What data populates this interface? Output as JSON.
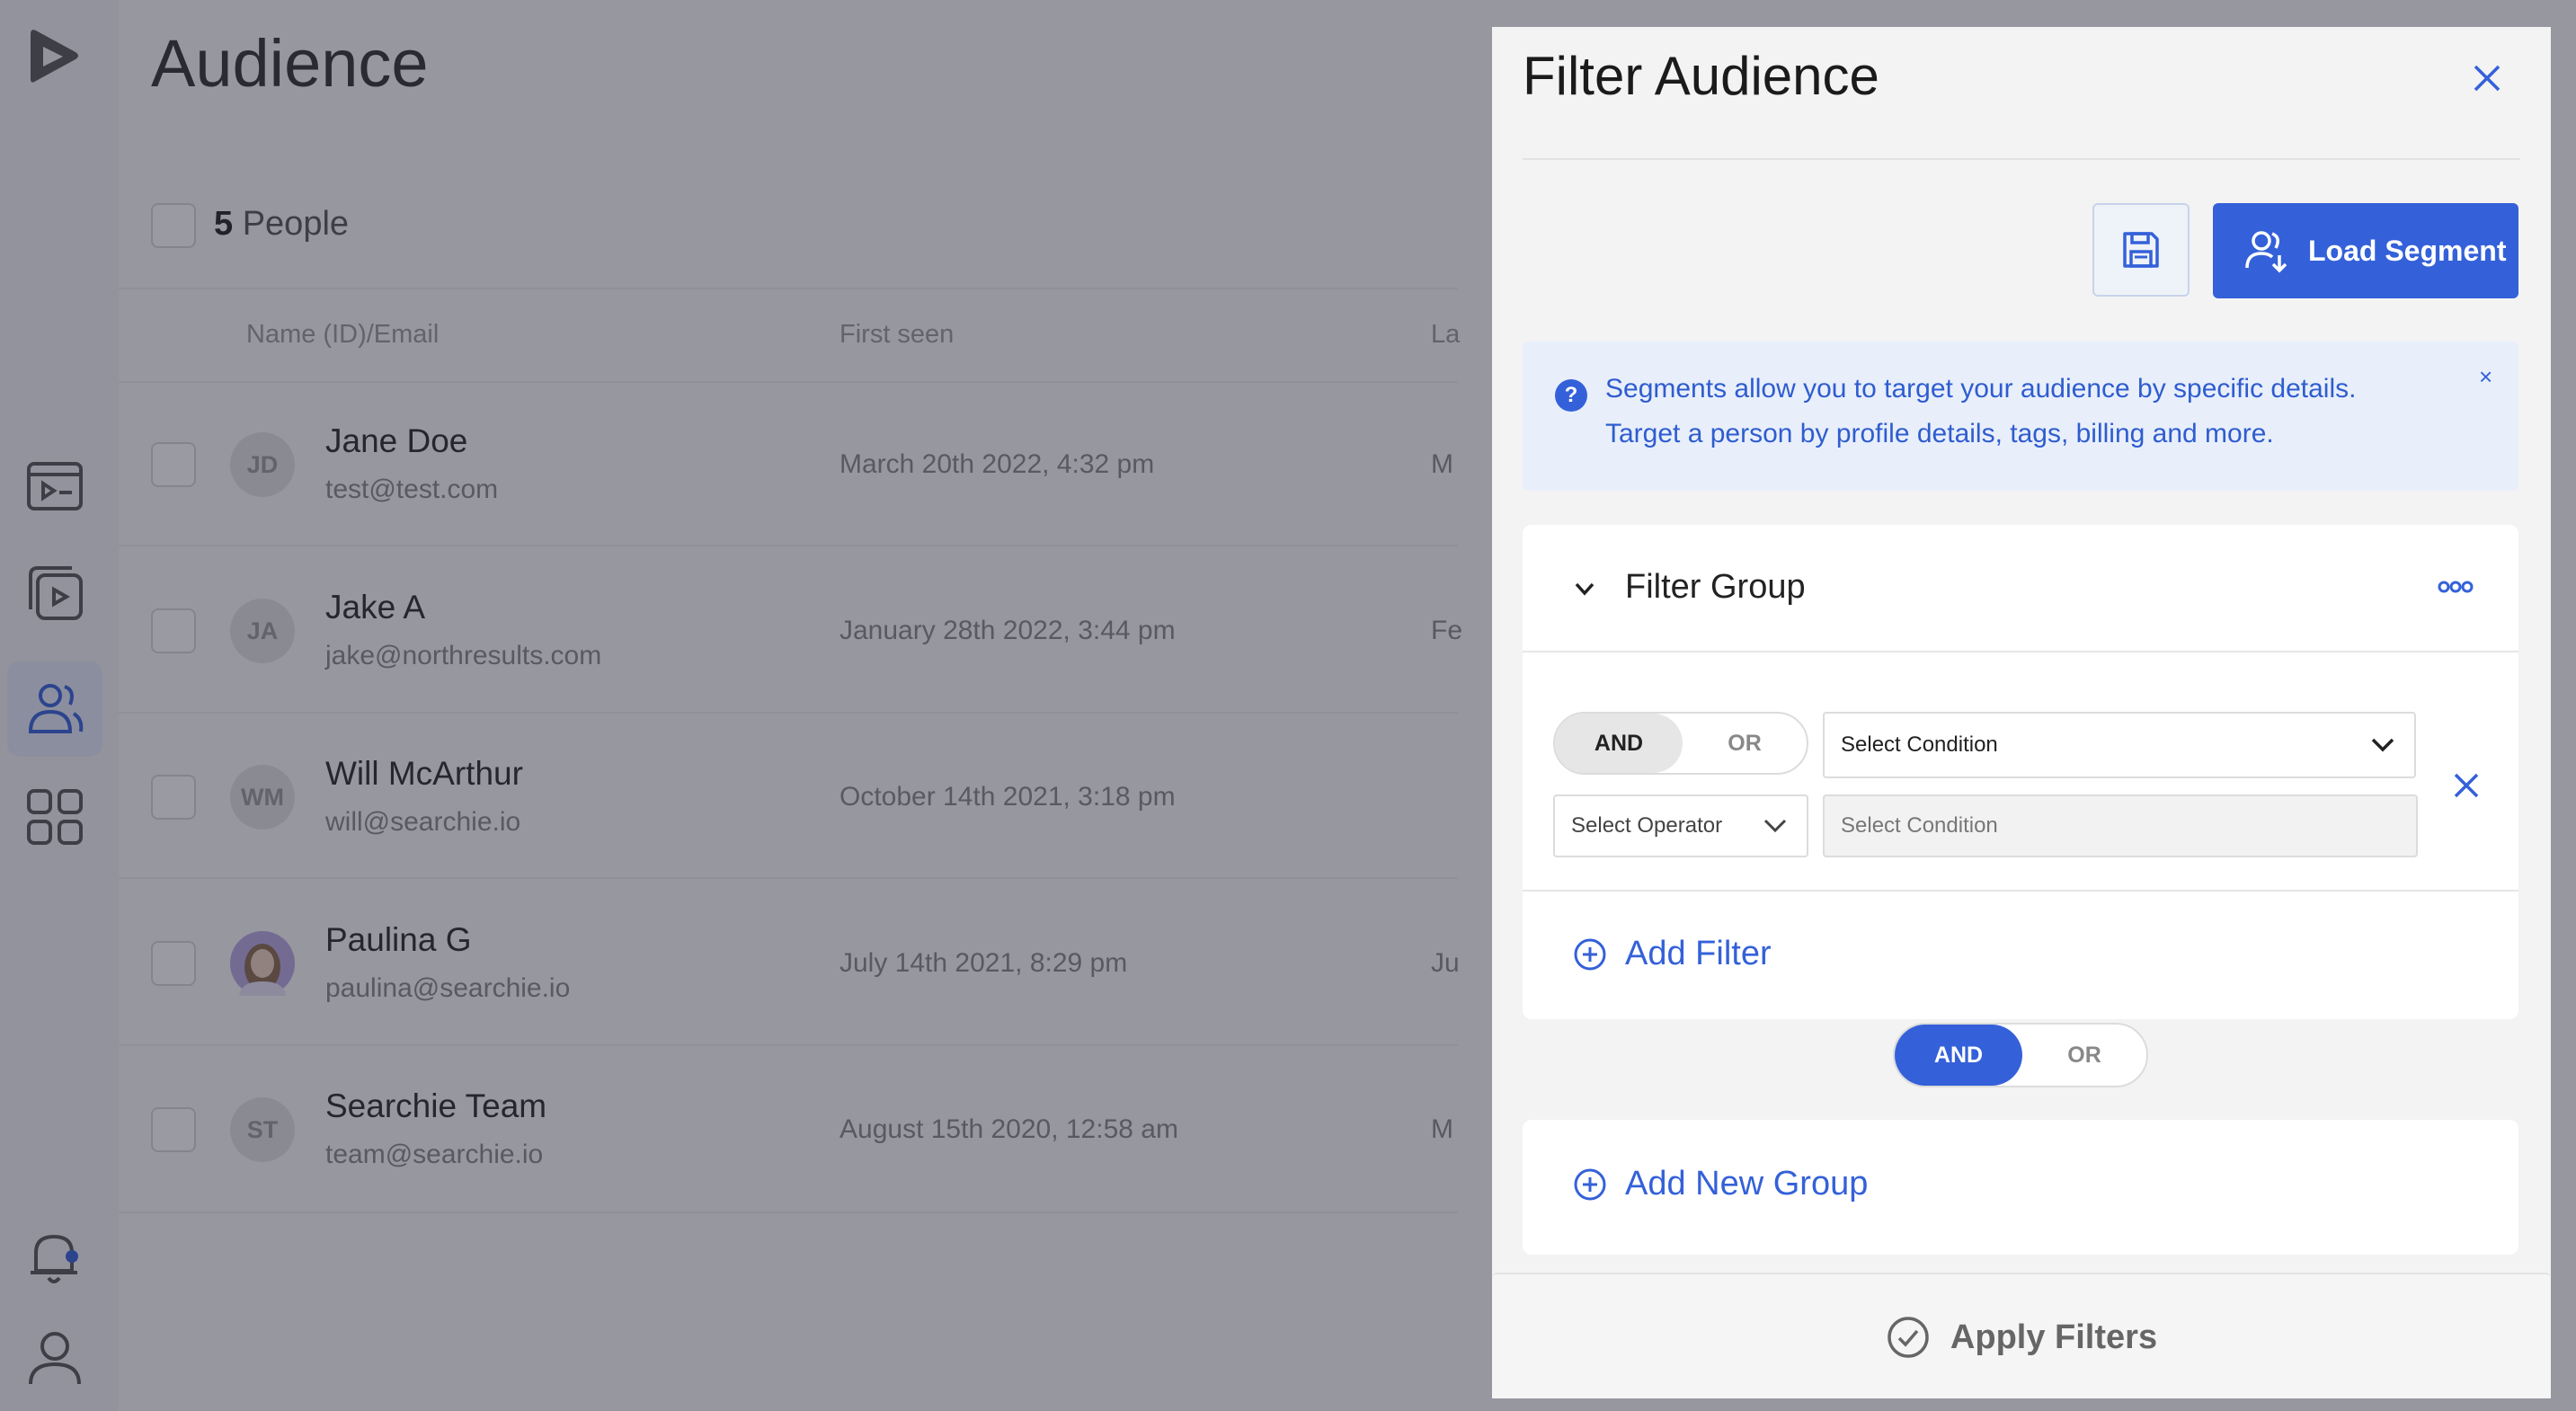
{
  "page": {
    "title": "Audience",
    "count_number": "5",
    "count_label": "People"
  },
  "table": {
    "columns": [
      "Name (ID)/Email",
      "First seen",
      "La"
    ],
    "rows": [
      {
        "initials": "JD",
        "name": "Jane Doe",
        "email": "test@test.com",
        "first_seen": "March 20th 2022, 4:32 pm",
        "last": "M"
      },
      {
        "initials": "JA",
        "name": "Jake A",
        "email": "jake@northresults.com",
        "first_seen": "January 28th 2022, 3:44 pm",
        "last": "Fe"
      },
      {
        "initials": "WM",
        "name": "Will McArthur",
        "email": "will@searchie.io",
        "first_seen": "October 14th 2021, 3:18 pm",
        "last": ""
      },
      {
        "initials": "",
        "name": "Paulina G",
        "email": "paulina@searchie.io",
        "first_seen": "July 14th 2021, 8:29 pm",
        "last": "Ju"
      },
      {
        "initials": "ST",
        "name": "Searchie Team",
        "email": "team@searchie.io",
        "first_seen": "August 15th 2020, 12:58 am",
        "last": "M"
      }
    ]
  },
  "sidebar": {
    "icons": [
      "logo-icon",
      "playlist-icon",
      "video-library-icon",
      "audience-icon",
      "apps-grid-icon",
      "notification-bell-icon",
      "user-profile-icon"
    ]
  },
  "filter_panel": {
    "title": "Filter Audience",
    "load_segment_label": "Load Segment",
    "info_line1": "Segments allow you to target your audience by specific details.",
    "info_line2": "Target a person by profile details, tags, billing and more.",
    "info_close": "×",
    "group": {
      "title": "Filter Group",
      "and_label": "AND",
      "or_label": "OR",
      "condition_placeholder": "Select Condition",
      "operator_placeholder": "Select Operator",
      "value_placeholder": "Select Condition",
      "add_filter_label": "Add Filter"
    },
    "between_groups": {
      "and_label": "AND",
      "or_label": "OR",
      "selected": "AND"
    },
    "add_group_label": "Add New Group",
    "apply_label": "Apply Filters"
  },
  "colors": {
    "accent": "#3461d9",
    "info_bg": "#e8effb"
  }
}
